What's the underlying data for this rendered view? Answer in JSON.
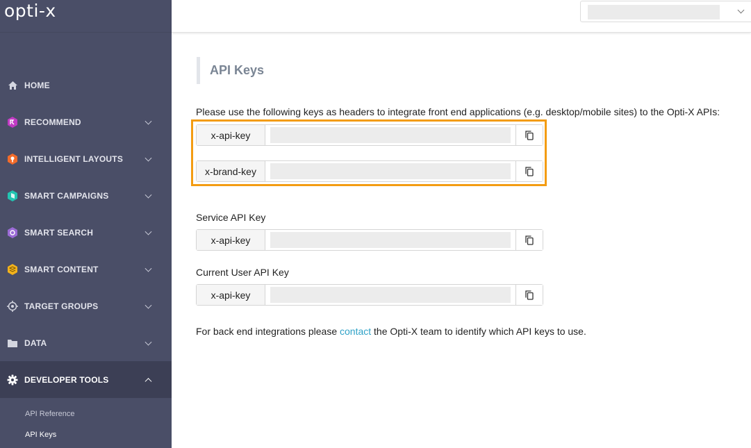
{
  "app": {
    "logo": "opti-x"
  },
  "sidebar": {
    "items": [
      {
        "label": "HOME",
        "icon": "home-icon"
      },
      {
        "label": "RECOMMEND",
        "icon": "recommend-icon",
        "color": "#c13bc4"
      },
      {
        "label": "INTELLIGENT LAYOUTS",
        "icon": "layouts-icon",
        "color": "#f26b2a"
      },
      {
        "label": "SMART CAMPAIGNS",
        "icon": "campaigns-icon",
        "color": "#22c4b1"
      },
      {
        "label": "SMART SEARCH",
        "icon": "search-icon",
        "color": "#9b6bd6"
      },
      {
        "label": "SMART CONTENT",
        "icon": "content-icon",
        "color": "#f2b21c"
      },
      {
        "label": "TARGET GROUPS",
        "icon": "target-icon"
      },
      {
        "label": "DATA",
        "icon": "folder-icon"
      },
      {
        "label": "DEVELOPER TOOLS",
        "icon": "gear-icon"
      }
    ],
    "subitems": [
      {
        "label": "API Reference"
      },
      {
        "label": "API Keys"
      }
    ]
  },
  "main": {
    "title": "API Keys",
    "intro": "Please use the following keys as headers to integrate front end applications (e.g. desktop/mobile sites) to the Opti-X APIs:",
    "frontend_keys": [
      {
        "name": "x-api-key"
      },
      {
        "name": "x-brand-key"
      }
    ],
    "service_label": "Service API Key",
    "service_key": {
      "name": "x-api-key"
    },
    "user_label": "Current User API Key",
    "user_key": {
      "name": "x-api-key"
    },
    "footer_before": "For back end integrations please ",
    "footer_link": "contact",
    "footer_after": " the Opti-X team to identify which API keys to use."
  },
  "colors": {
    "sidebar_bg": "#4a4e67",
    "highlight": "#f39c12",
    "link": "#2fa2c7"
  }
}
